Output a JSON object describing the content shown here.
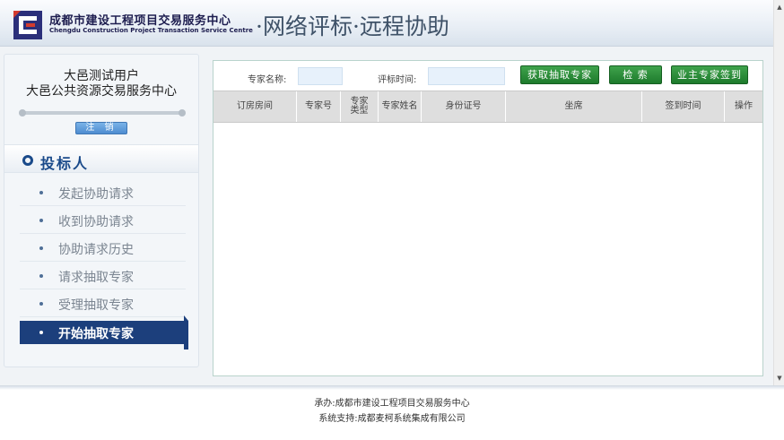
{
  "header": {
    "org_name_cn": "成都市建设工程项目交易服务中心",
    "org_name_en": "Chengdu Construction Project Transaction Service Centre",
    "system_title": "·网络评标·远程协助"
  },
  "user": {
    "name": "大邑测试用户",
    "org": "大邑公共资源交易服务中心",
    "logout_label": "注 销"
  },
  "sidebar": {
    "section_title": "投标人",
    "items": [
      {
        "label": "发起协助请求"
      },
      {
        "label": "收到协助请求"
      },
      {
        "label": "协助请求历史"
      },
      {
        "label": "请求抽取专家"
      },
      {
        "label": "受理抽取专家"
      },
      {
        "label": "开始抽取专家"
      }
    ]
  },
  "search": {
    "expert_name_label": "专家名称:",
    "expert_name_value": "",
    "review_time_label": "评标时间:",
    "review_time_value": "",
    "fetch_button": "获取抽取专家",
    "search_button": "检 索",
    "sign_in_button": "业主专家签到"
  },
  "table": {
    "columns": [
      {
        "label": "订房房间"
      },
      {
        "label": "专家号"
      },
      {
        "label": "专家类型"
      },
      {
        "label": "专家姓名"
      },
      {
        "label": "身份证号"
      },
      {
        "label": "坐席"
      },
      {
        "label": "签到时间"
      },
      {
        "label": "操作"
      }
    ],
    "rows": []
  },
  "footer": {
    "host": "承办:成都市建设工程项目交易服务中心",
    "support": "系统支持:成都麦柯系统集成有限公司"
  },
  "colors": {
    "brand_navy": "#1a4a8a",
    "active_menu": "#1c3f7c",
    "button_green": "#2b8a39",
    "logout_blue": "#5f9ad9"
  }
}
